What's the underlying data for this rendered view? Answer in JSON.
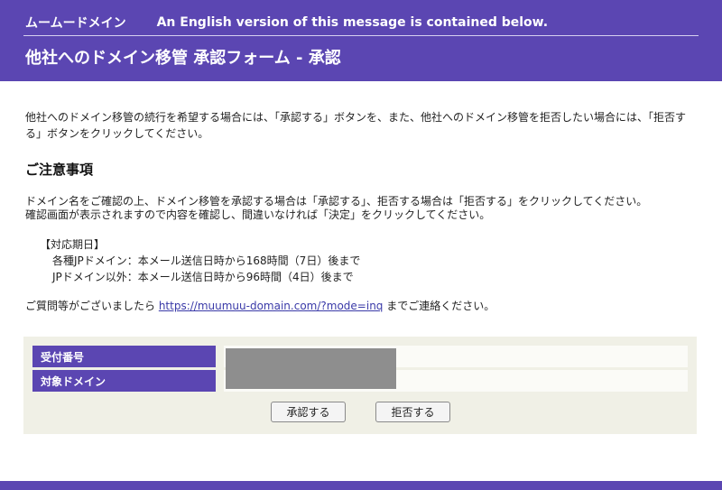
{
  "header": {
    "brand": "ムームードメイン",
    "english_notice": "An English version of this message is contained below.",
    "title": "他社へのドメイン移管 承認フォーム - 承認"
  },
  "intro": "他社へのドメイン移管の続行を希望する場合には、「承認する」ボタンを、また、他社へのドメイン移管を拒否したい場合には、「拒否する」ボタンをクリックしてください。",
  "notes": {
    "heading": "ご注意事項",
    "line1": "ドメイン名をご確認の上、ドメイン移管を承認する場合は「承認する」、拒否する場合は「拒否する」をクリックしてください。",
    "line2": "確認画面が表示されますので内容を確認し、間違いなければ「決定」をクリックしてください。"
  },
  "deadline": {
    "heading": "【対応期日】",
    "item1": "各種JPドメイン：本メール送信日時から168時間（7日）後まで",
    "item2": "JPドメイン以外：本メール送信日時から96時間（4日）後まで"
  },
  "contact": {
    "prefix": "ご質問等がございましたら ",
    "link": "https://muumuu-domain.com/?mode=inq",
    "suffix": " までご連絡ください。"
  },
  "form": {
    "fields": [
      {
        "label": "受付番号"
      },
      {
        "label": "対象ドメイン"
      }
    ],
    "approve_label": "承認する",
    "reject_label": "拒否する"
  },
  "colors": {
    "brand": "#5b46b2",
    "form_bg": "#f0f0e6",
    "link": "#3a3aa8"
  }
}
